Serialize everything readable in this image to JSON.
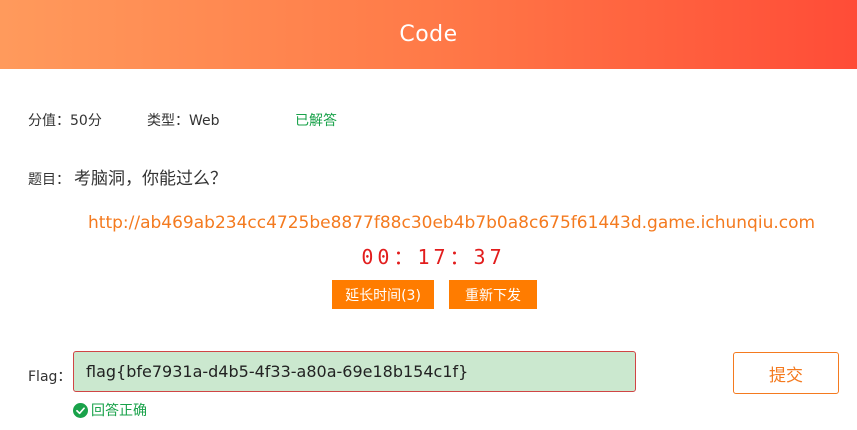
{
  "header": {
    "title": "Code"
  },
  "meta": {
    "score": "分值：50分",
    "type": "类型：Web",
    "status": "已解答"
  },
  "question": {
    "label": "题目：",
    "text": "考脑洞，你能过么？"
  },
  "challenge": {
    "url": "http://ab469ab234cc4725be8877f88c30eb4b7b0a8c675f61443d.game.ichunqiu.com",
    "timer": "00：17：37"
  },
  "buttons": {
    "extend": "延长时间(3)",
    "reissue": "重新下发",
    "submit": "提交"
  },
  "flag": {
    "label": "Flag：",
    "value": "flag{bfe7931a-d4b5-4f33-a80a-69e18b154c1f}"
  },
  "result": {
    "icon": "check-circle-icon",
    "text": "回答正确"
  },
  "colors": {
    "header_start": "#ff9a5c",
    "header_end": "#ff4c37",
    "accent": "#f47a1f",
    "button": "#ff7c00",
    "success": "#19a24a",
    "timer": "#e21d1d"
  }
}
